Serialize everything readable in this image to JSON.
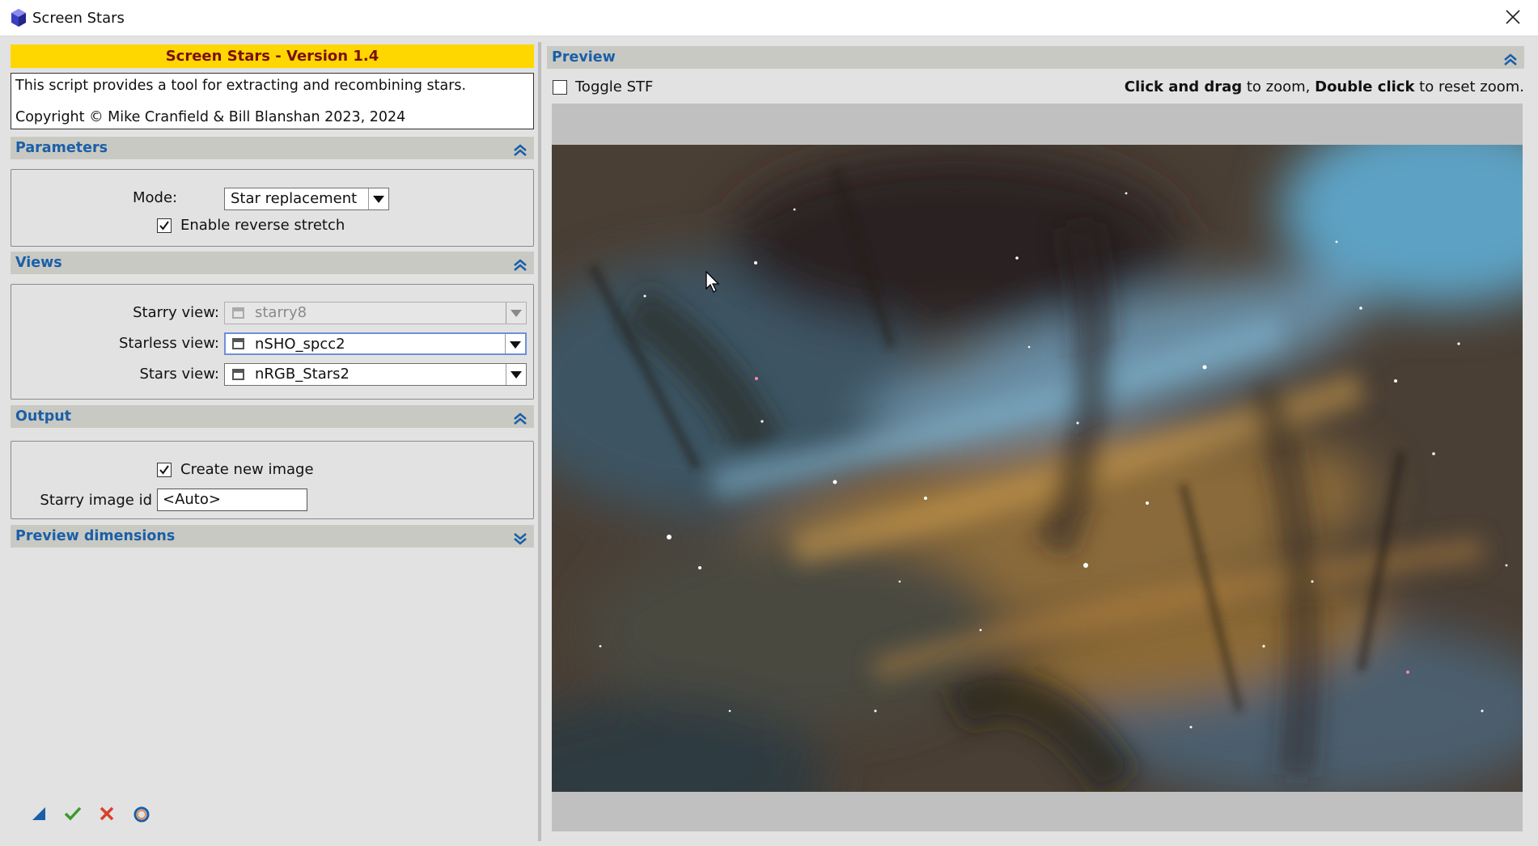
{
  "window": {
    "title": "Screen Stars",
    "close_icon": "close-icon",
    "app_icon": "pixinsight-icon"
  },
  "banner": {
    "text": "Screen Stars - Version 1.4"
  },
  "info": {
    "line1": "This script provides a tool for extracting and recombining stars.",
    "line2": "Copyright © Mike Cranfield & Bill Blanshan 2023, 2024"
  },
  "parameters": {
    "header": "Parameters",
    "mode_label": "Mode:",
    "mode_value": "Star replacement",
    "reverse_stretch_label": "Enable reverse stretch",
    "reverse_stretch_checked": true
  },
  "views": {
    "header": "Views",
    "starry_label": "Starry view:",
    "starry_value": "starry8",
    "starless_label": "Starless view:",
    "starless_value": "nSHO_spcc2",
    "stars_label": "Stars view:",
    "stars_value": "nRGB_Stars2"
  },
  "output": {
    "header": "Output",
    "create_new_label": "Create new image",
    "create_new_checked": true,
    "image_id_label": "Starry image id",
    "image_id_value": "<Auto>"
  },
  "preview_dimensions": {
    "header": "Preview dimensions"
  },
  "preview": {
    "header": "Preview",
    "toggle_stf_label": "Toggle STF",
    "toggle_stf_checked": false,
    "hint_bold1": "Click and drag",
    "hint_text1": " to zoom, ",
    "hint_bold2": "Double click",
    "hint_text2": " to reset zoom."
  },
  "bottom_buttons": [
    "new-instance-icon",
    "ok-check-icon",
    "cancel-x-icon",
    "reset-circle-icon"
  ],
  "colors": {
    "accent_blue": "#1a5fa8",
    "banner_yellow": "#ffd700",
    "banner_text": "#7a1010",
    "header_bg": "#c9c9c3"
  }
}
